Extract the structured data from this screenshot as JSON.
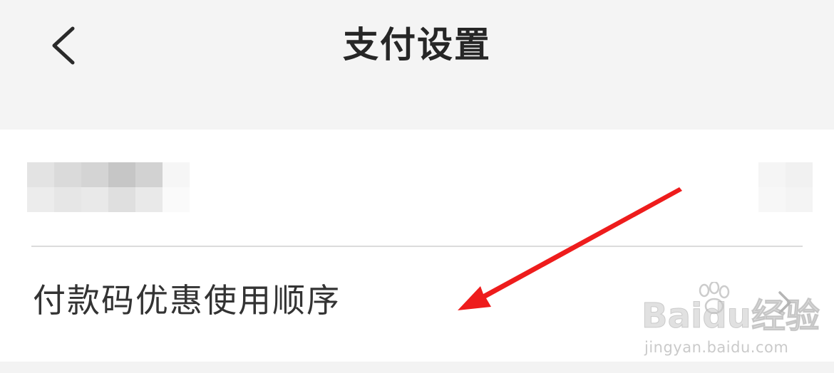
{
  "header": {
    "title": "支付设置",
    "back_icon": "chevron-left-icon"
  },
  "list": {
    "row_order": {
      "label": "付款码优惠使用顺序",
      "chevron_icon": "chevron-right-icon"
    }
  },
  "annotation": {
    "arrow_color": "#ee1c1c"
  },
  "watermark": {
    "logo_text": "Baidu经验",
    "url": "jingyan.baidu.com"
  },
  "colors": {
    "background": "#f4f4f4",
    "card": "#ffffff",
    "text": "#262626",
    "divider": "#dcdcdc"
  }
}
